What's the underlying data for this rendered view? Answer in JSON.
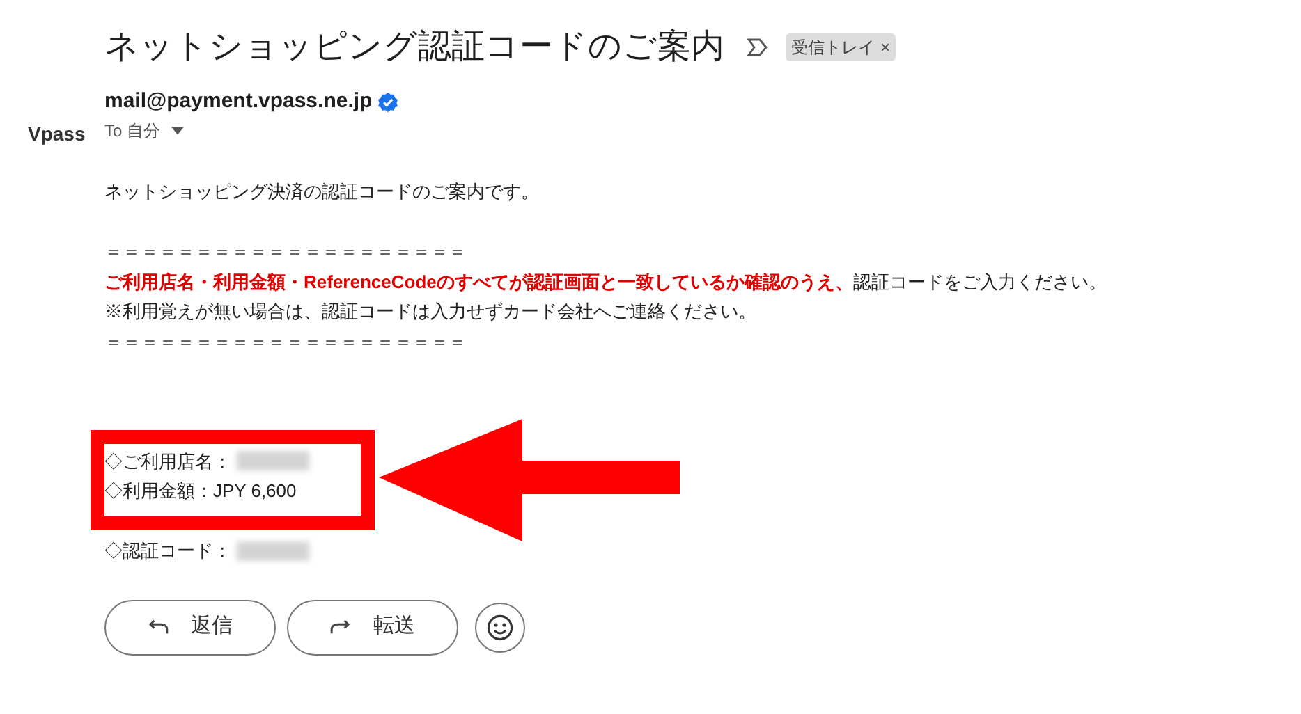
{
  "subject": "ネットショッピング認証コードのご案内",
  "label": {
    "text": "受信トレイ",
    "close": "×"
  },
  "sender": {
    "avatar": "Vpass",
    "email": "mail@payment.vpass.ne.jp",
    "verified": true,
    "recipient": "To 自分"
  },
  "body": {
    "intro": "ネットショッピング決済の認証コードのご案内です。",
    "separator_top": "＝＝＝＝＝＝＝＝＝＝＝＝＝＝＝＝＝＝＝＝",
    "notice": "**ご利用店名・利用金額・ReferenceCodeのすべてが認証画面と一致しているか確認のうえ、**認証コードをご入力ください。",
    "note": "※利用覚えが無い場合は、認証コードは入力せずカード会社へご連絡ください。",
    "separator_bottom": "＝＝＝＝＝＝＝＝＝＝＝＝＝＝＝＝＝＝＝＝",
    "details": [
      {
        "kind": "covered"
      },
      {
        "kind": "redacted",
        "label": "◇ご利用店名："
      },
      {
        "kind": "text",
        "label": "◇利用金額：",
        "value": "JPY 6,600"
      },
      {
        "kind": "covered"
      },
      {
        "kind": "redacted",
        "label": "◇認証コード："
      }
    ]
  },
  "actions": [
    {
      "kind": "reply",
      "label": "返信"
    },
    {
      "kind": "forward",
      "label": "転送"
    },
    {
      "kind": "emoji"
    }
  ]
}
